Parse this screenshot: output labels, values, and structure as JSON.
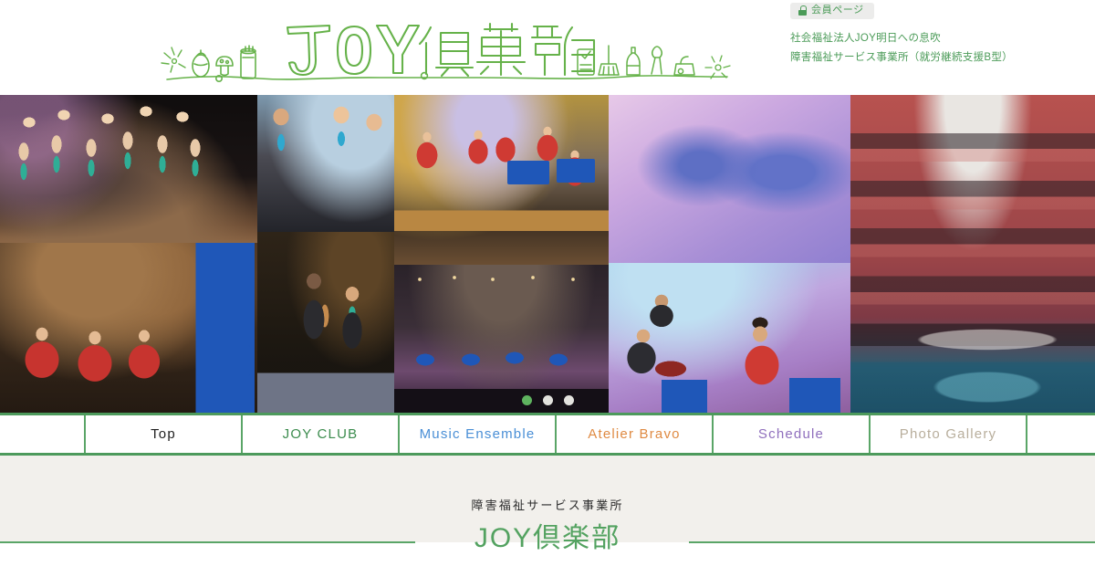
{
  "header": {
    "member_button": {
      "icon": "lock-icon",
      "label": "会員ページ"
    },
    "org_lines": [
      "社会福祉法人JOY明日への息吹",
      "障害福祉サービス事業所（就労継続支援B型）"
    ],
    "logo": {
      "text": "JOY倶楽部",
      "doodles_left": [
        "sparkle",
        "egg-plant",
        "mushroom",
        "spray-can"
      ],
      "doodles_right": [
        "notebook",
        "broom",
        "watering-can",
        "paint-brush",
        "vacuum",
        "sparkle"
      ],
      "color": "#66b24a"
    }
  },
  "carousel": {
    "tiles": [
      {
        "name": "choir-raising-hands",
        "alt": "黒い衣装に緑のスカーフの合唱団が手を挙げるステージ写真"
      },
      {
        "name": "members-with-stand",
        "alt": "譜面台を囲むメンバーたちの写真"
      },
      {
        "name": "percussion-ensemble-red-jackets",
        "alt": "赤いジャケットのパーカッション演奏"
      },
      {
        "name": "joy-letters-backdrop",
        "alt": "JOYの文字の背景ステージ"
      },
      {
        "name": "atrium-hall-concert",
        "alt": "キャナルシティ劇場の吹き抜けコンサート"
      },
      {
        "name": "guitar-duo-stage",
        "alt": "サックスとギターのデュオ"
      },
      {
        "name": "joy-club-band-stage",
        "alt": "JOY CLUB バンドステージ"
      },
      {
        "name": "hall-wide-shot",
        "alt": "ホール全景の演奏風景"
      },
      {
        "name": "accordion-players",
        "alt": "アコーディオン奏者たち"
      }
    ],
    "dots": [
      {
        "label": "1",
        "active": true
      },
      {
        "label": "2",
        "active": false
      },
      {
        "label": "3",
        "active": false
      }
    ]
  },
  "nav": {
    "items": [
      {
        "label": "Top",
        "color": "#1f1f1f",
        "active": true
      },
      {
        "label": "JOY CLUB",
        "color": "#3c8c4e",
        "active": false
      },
      {
        "label": "Music Ensemble",
        "color": "#4a8fd6",
        "active": false
      },
      {
        "label": "Atelier Bravo",
        "color": "#df8a42",
        "active": false
      },
      {
        "label": "Schedule",
        "color": "#8f6fbd",
        "active": false
      },
      {
        "label": "Photo Gallery",
        "color": "#b8ae9c",
        "active": false
      }
    ]
  },
  "band": {
    "subtitle": "障害福祉サービス事業所",
    "title": "JOY倶楽部"
  },
  "colors": {
    "green": "#4d9a5c",
    "green_light": "#5aa567",
    "logo_green": "#66b24a",
    "band_bg": "#f2f0ec",
    "member_btn_bg": "#ececeb"
  }
}
